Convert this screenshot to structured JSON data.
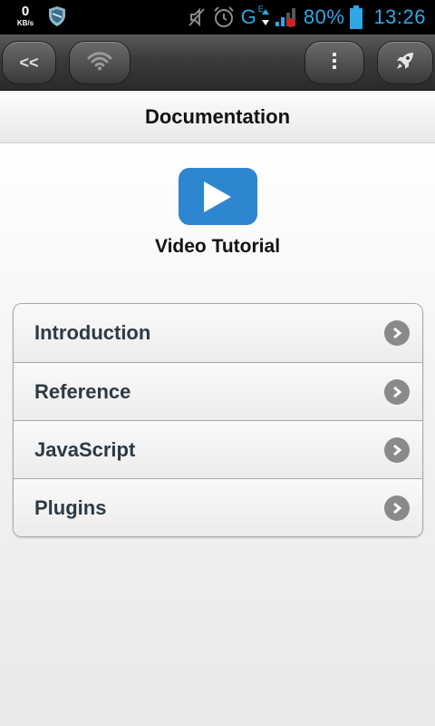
{
  "statusbar": {
    "speed_value": "0",
    "speed_unit": "KB/s",
    "network": "G",
    "network_sub": "E",
    "battery": "80%",
    "clock": "13:26",
    "accent_color": "#2fa6e6"
  },
  "toolbar": {
    "back_label": "<<"
  },
  "header": {
    "title": "Documentation"
  },
  "video": {
    "label": "Video Tutorial",
    "icon": "play-icon",
    "color": "#2d86cf"
  },
  "menu": {
    "items": [
      {
        "label": "Introduction",
        "icon": "chevron-right-icon"
      },
      {
        "label": "Reference",
        "icon": "chevron-right-icon"
      },
      {
        "label": "JavaScript",
        "icon": "chevron-right-icon"
      },
      {
        "label": "Plugins",
        "icon": "chevron-right-icon"
      }
    ]
  }
}
